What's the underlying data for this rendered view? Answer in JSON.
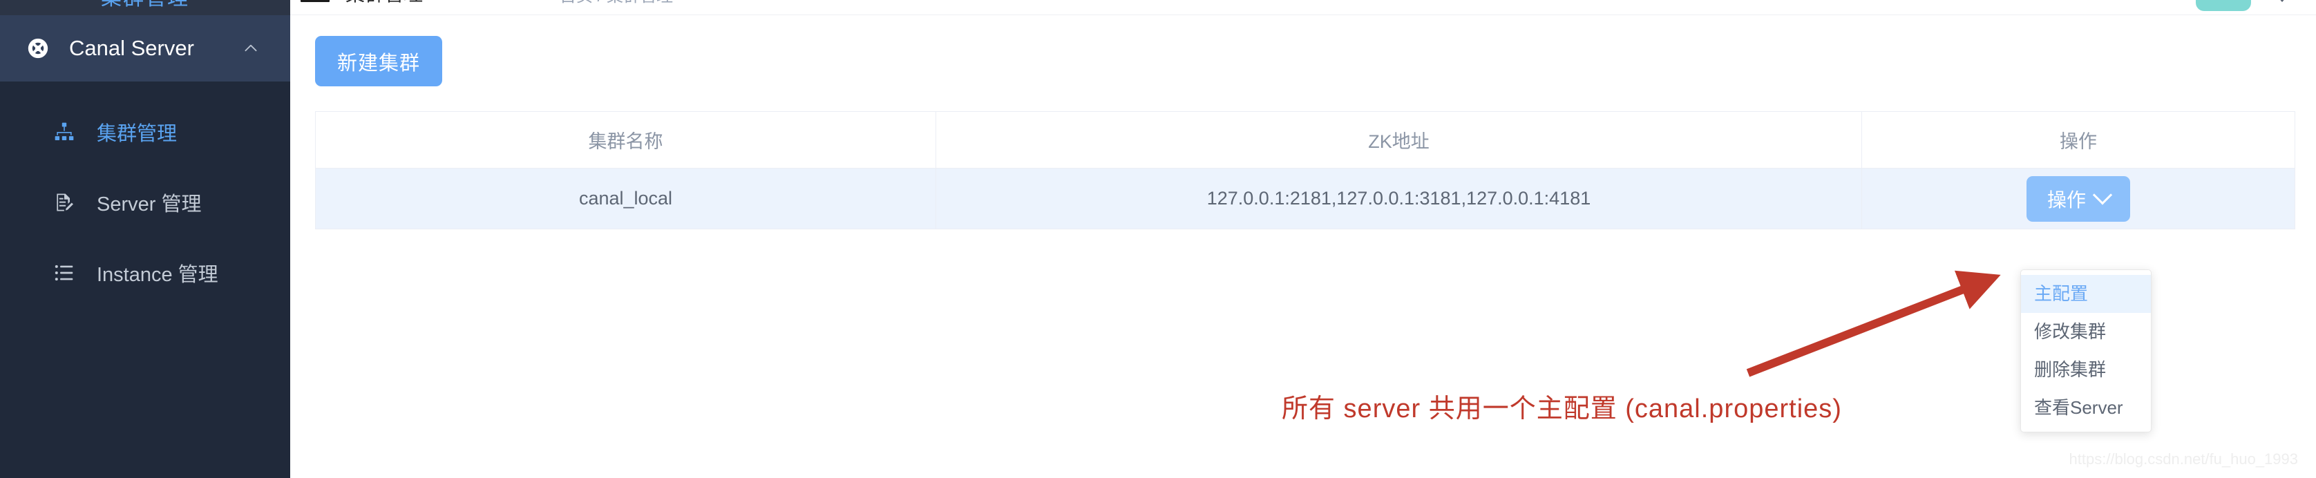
{
  "sidebar": {
    "clipped_title_above": "集群管理",
    "group": {
      "label": "Canal Server",
      "icon": "lifebuoy-icon",
      "collapse_icon": "chevron-up-icon"
    },
    "items": [
      {
        "label": "集群管理",
        "icon": "sitemap-icon",
        "active": true
      },
      {
        "label": "Server 管理",
        "icon": "document-edit-icon",
        "active": false
      },
      {
        "label": "Instance 管理",
        "icon": "list-icon",
        "active": false
      }
    ]
  },
  "topbar": {
    "menu_icon": "hamburger-icon",
    "title": "集群管理",
    "breadcrumb": "首页 / 集群管理",
    "avatar_icon": "user-avatar",
    "avatar_color": "#7fd8d3",
    "caret_icon": "caret-down-icon"
  },
  "toolbar": {
    "new_cluster_label": "新建集群"
  },
  "table": {
    "columns": [
      "集群名称",
      "ZK地址",
      "操作"
    ],
    "rows": [
      {
        "name": "canal_local",
        "zk_address": "127.0.0.1:2181,127.0.0.1:3181,127.0.0.1:4181",
        "action_label": "操作"
      }
    ]
  },
  "dropdown": {
    "items": [
      {
        "label": "主配置",
        "highlighted": true
      },
      {
        "label": "修改集群",
        "highlighted": false
      },
      {
        "label": "删除集群",
        "highlighted": false
      },
      {
        "label": "查看Server",
        "highlighted": false
      }
    ]
  },
  "annotation": {
    "text": "所有 server 共用一个主配置 (canal.properties)",
    "color": "#c0392b",
    "arrow_target": "主配置"
  },
  "watermark": {
    "text": "https://blog.csdn.net/fu_huo_1993"
  },
  "colors": {
    "sidebar_bg": "#20293a",
    "sidebar_group_bg": "#32405a",
    "accent_blue": "#66a8f7",
    "row_bg": "#ecf3fd",
    "annotation_red": "#c0392b"
  }
}
